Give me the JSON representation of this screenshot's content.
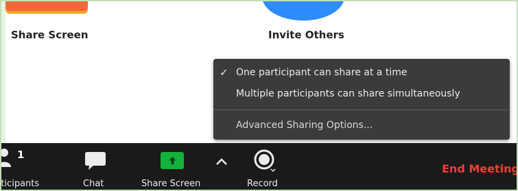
{
  "main": {
    "share_screen_label": "Share Screen",
    "invite_others_label": "Invite Others"
  },
  "share_menu": {
    "items": [
      {
        "label": "One participant can share at a time",
        "checked": true,
        "check_glyph": "✓"
      },
      {
        "label": "Multiple participants can share simultaneously",
        "checked": false
      },
      {
        "label": "Advanced Sharing Options...",
        "checked": false
      }
    ]
  },
  "toolbar": {
    "participants": {
      "count": "1",
      "label": "rticipants",
      "icon": "person-icon"
    },
    "chat": {
      "label": "Chat",
      "icon": "chat-bubble-icon"
    },
    "share_screen": {
      "label": "Share Screen",
      "icon": "share-arrow-icon"
    },
    "share_options": {
      "icon": "caret-up-icon"
    },
    "record": {
      "label": "Record",
      "icon": "record-icon"
    },
    "end_meeting": {
      "label": "End Meeting"
    }
  },
  "colors": {
    "toolbar_bg": "#1a1a1a",
    "menu_bg": "#3b3b3d",
    "share_green": "#13b23b",
    "end_meeting_red": "#ef3e36",
    "invite_blue": "#2d8cff",
    "share_orange": "#f1683a"
  }
}
